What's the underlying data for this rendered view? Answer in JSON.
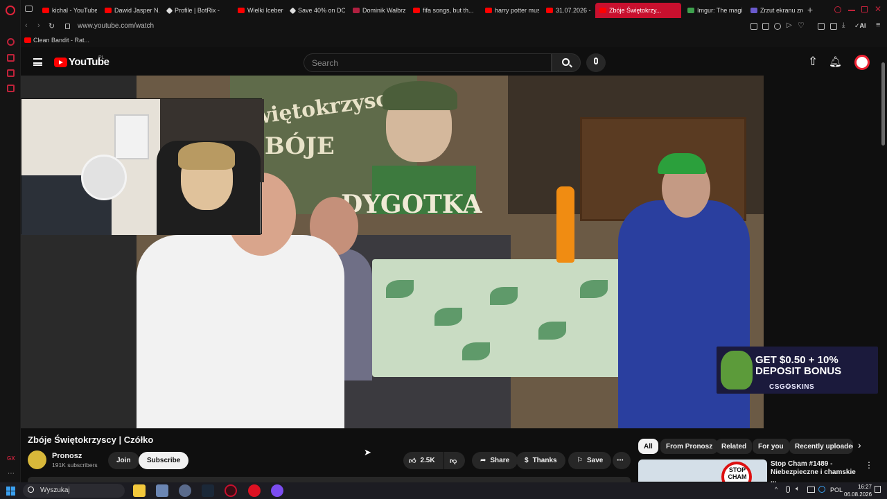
{
  "browser": {
    "tabs": [
      {
        "label": "kichal - YouTube",
        "favicon": "youtube-icon"
      },
      {
        "label": "Dawid Jasper N...",
        "favicon": "youtube-icon"
      },
      {
        "label": "Profile | BotRix -",
        "favicon": "botrix-icon"
      },
      {
        "label": "Wielki Iceberg B...",
        "favicon": "youtube-icon"
      },
      {
        "label": "Save 40% on DO...",
        "favicon": "steam-icon"
      },
      {
        "label": "Dominik Wałbrzy...",
        "favicon": "generic-icon"
      },
      {
        "label": "fifa songs, but th...",
        "favicon": "youtube-icon"
      },
      {
        "label": "harry potter mus...",
        "favicon": "youtube-icon"
      },
      {
        "label": "31.07.2026 - Gat...",
        "favicon": "youtube-icon"
      },
      {
        "label": "Zbóje Świętokrzy...",
        "favicon": "youtube-icon",
        "active": true
      },
      {
        "label": "Imgur: The magi...",
        "favicon": "imgur-icon"
      },
      {
        "label": "Zrzut ekranu zro...",
        "favicon": "feather-icon"
      }
    ],
    "url": "www.youtube.com/watch",
    "bookmark": "Clean Bandit - Rat...",
    "sidebar_gx_label": "GX"
  },
  "youtube": {
    "logo_text": "YouTube",
    "region": "PL",
    "search_placeholder": "Search"
  },
  "video": {
    "banner_line1": "Świętokrzyscy",
    "banner_line2": "ZBÓJE",
    "banner_line3": "DYGOTKA",
    "title": "Zbóje Świętokrzyscy | Czółko",
    "channel": "Pronosz",
    "subscribers": "191K subscribers",
    "join_label": "Join",
    "subscribe_label": "Subscribe",
    "likes": "2.5K",
    "share_label": "Share",
    "thanks_label": "Thanks",
    "save_label": "Save"
  },
  "ad": {
    "line1": "GET $0.50 + 10%",
    "line2": "DEPOSIT BONUS",
    "brand": "CSG✪SKINS"
  },
  "chips": [
    "All",
    "From Pronosz",
    "Related",
    "For you",
    "Recently uploaded"
  ],
  "recommendation": {
    "title": "Stop Cham #1489 - Niebezpieczne i chamskie ...",
    "thumb_text": "STOP CHAM"
  },
  "taskbar": {
    "search_placeholder": "Wyszukaj",
    "language": "POL",
    "time": "16:27",
    "date": "06.08.2026"
  },
  "colors": {
    "active_tab": "#c8102e",
    "youtube_red": "#ff0000",
    "background": "#0f0f0f"
  }
}
